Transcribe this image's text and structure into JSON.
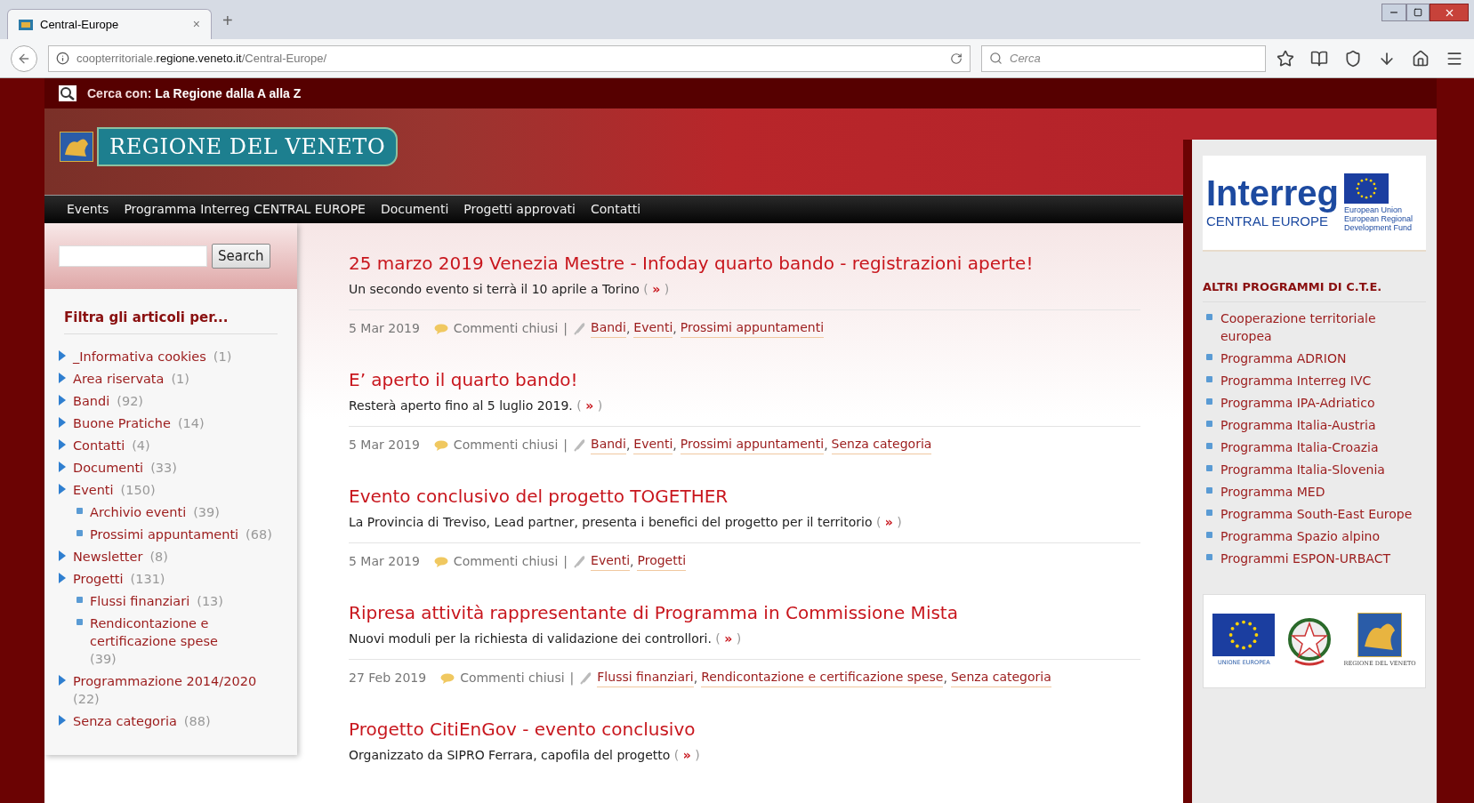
{
  "browser": {
    "tab": {
      "title": "Central-Europe",
      "close": "×",
      "new_tab": "+"
    },
    "url": {
      "prefix": "coopterritoriale.",
      "domain": "regione.veneto.it",
      "path": "/Central-Europe/"
    },
    "search": {
      "placeholder": "Cerca"
    }
  },
  "topbar": {
    "label": "Cerca con:",
    "link": "La Regione dalla A alla Z"
  },
  "header": {
    "logo_text": "REGIONE DEL VENETO"
  },
  "nav": [
    "Events",
    "Programma Interreg CENTRAL EUROPE",
    "Documenti",
    "Progetti approvati",
    "Contatti"
  ],
  "left_sidebar": {
    "search_button": "Search",
    "filter_title": "Filtra gli articoli per...",
    "categories": [
      {
        "name": "_Informativa cookies",
        "count": "(1)"
      },
      {
        "name": "Area riservata",
        "count": "(1)"
      },
      {
        "name": "Bandi",
        "count": "(92)"
      },
      {
        "name": "Buone Pratiche",
        "count": "(14)"
      },
      {
        "name": "Contatti",
        "count": "(4)"
      },
      {
        "name": "Documenti",
        "count": "(33)"
      },
      {
        "name": "Eventi",
        "count": "(150)",
        "children": [
          {
            "name": "Archivio eventi",
            "count": "(39)"
          },
          {
            "name": "Prossimi appuntamenti",
            "count": "(68)"
          }
        ]
      },
      {
        "name": "Newsletter",
        "count": "(8)"
      },
      {
        "name": "Progetti",
        "count": "(131)",
        "children": [
          {
            "name": "Flussi finanziari",
            "count": "(13)"
          },
          {
            "name": "Rendicontazione e certificazione spese",
            "count": "(39)"
          }
        ]
      },
      {
        "name": "Programmazione 2014/2020",
        "count": "(22)"
      },
      {
        "name": "Senza categoria",
        "count": "(88)"
      }
    ]
  },
  "posts": [
    {
      "title": "25 marzo 2019 Venezia Mestre - Infoday quarto bando - registrazioni aperte!",
      "excerpt": "Un secondo evento si terrà il 10 aprile a Torino",
      "more_open": "(",
      "more_link": "»",
      "more_close": ")",
      "date": "5 Mar 2019",
      "comments": "Commenti chiusi",
      "separator": "|",
      "tags": [
        {
          "label": "Bandi",
          "after": ","
        },
        {
          "label": "Eventi",
          "after": ","
        },
        {
          "label": "Prossimi appuntamenti"
        }
      ]
    },
    {
      "title": "E’ aperto il quarto bando!",
      "excerpt": "Resterà aperto fino al 5 luglio 2019.",
      "more_open": "(",
      "more_link": "»",
      "more_close": ")",
      "date": "5 Mar 2019",
      "comments": "Commenti chiusi",
      "separator": "|",
      "tags": [
        {
          "label": "Bandi",
          "after": ","
        },
        {
          "label": "Eventi",
          "after": ","
        },
        {
          "label": "Prossimi appuntamenti",
          "after": ","
        },
        {
          "label": "Senza categoria"
        }
      ]
    },
    {
      "title": "Evento conclusivo del progetto TOGETHER",
      "excerpt": "La Provincia di Treviso, Lead partner, presenta i benefici del progetto per il territorio",
      "more_open": "(",
      "more_link": "»",
      "more_close": ")",
      "date": "5 Mar 2019",
      "comments": "Commenti chiusi",
      "separator": "|",
      "tags": [
        {
          "label": "Eventi",
          "after": ","
        },
        {
          "label": "Progetti"
        }
      ]
    },
    {
      "title": "Ripresa attività rappresentante di Programma in Commissione Mista",
      "excerpt": "Nuovi moduli per la richiesta di validazione dei controllori.",
      "more_open": "(",
      "more_link": "»",
      "more_close": ")",
      "date": "27 Feb 2019",
      "comments": "Commenti chiusi",
      "separator": "|",
      "tags": [
        {
          "label": "Flussi finanziari",
          "after": ","
        },
        {
          "label": "Rendicontazione e certificazione spese",
          "after": ","
        },
        {
          "label": "Senza categoria"
        }
      ]
    },
    {
      "title": "Progetto CitiEnGov - evento conclusivo",
      "excerpt": "Organizzato da SIPRO Ferrara, capofila del progetto",
      "more_open": "(",
      "more_link": "»",
      "more_close": ")"
    }
  ],
  "right_sidebar": {
    "interreg_logo": {
      "word": "Interreg",
      "program": "CENTRAL EUROPE",
      "fund_lines": [
        "European Union",
        "European Regional",
        "Development Fund"
      ]
    },
    "title": "ALTRI PROGRAMMI DI C.T.E.",
    "links": [
      "Cooperazione territoriale europea",
      "Programma ADRION",
      "Programma Interreg IVC",
      "Programma IPA-Adriatico",
      "Programma Italia-Austria",
      "Programma Italia-Croazia",
      "Programma Italia-Slovenia",
      "Programma MED",
      "Programma South-East Europe",
      "Programma Spazio alpino",
      "Programmi ESPON-URBACT"
    ],
    "footer_logos": {
      "eu_caption": "UNIONE EUROPEA",
      "veneto_caption": "REGIONE DEL VENETO"
    }
  }
}
